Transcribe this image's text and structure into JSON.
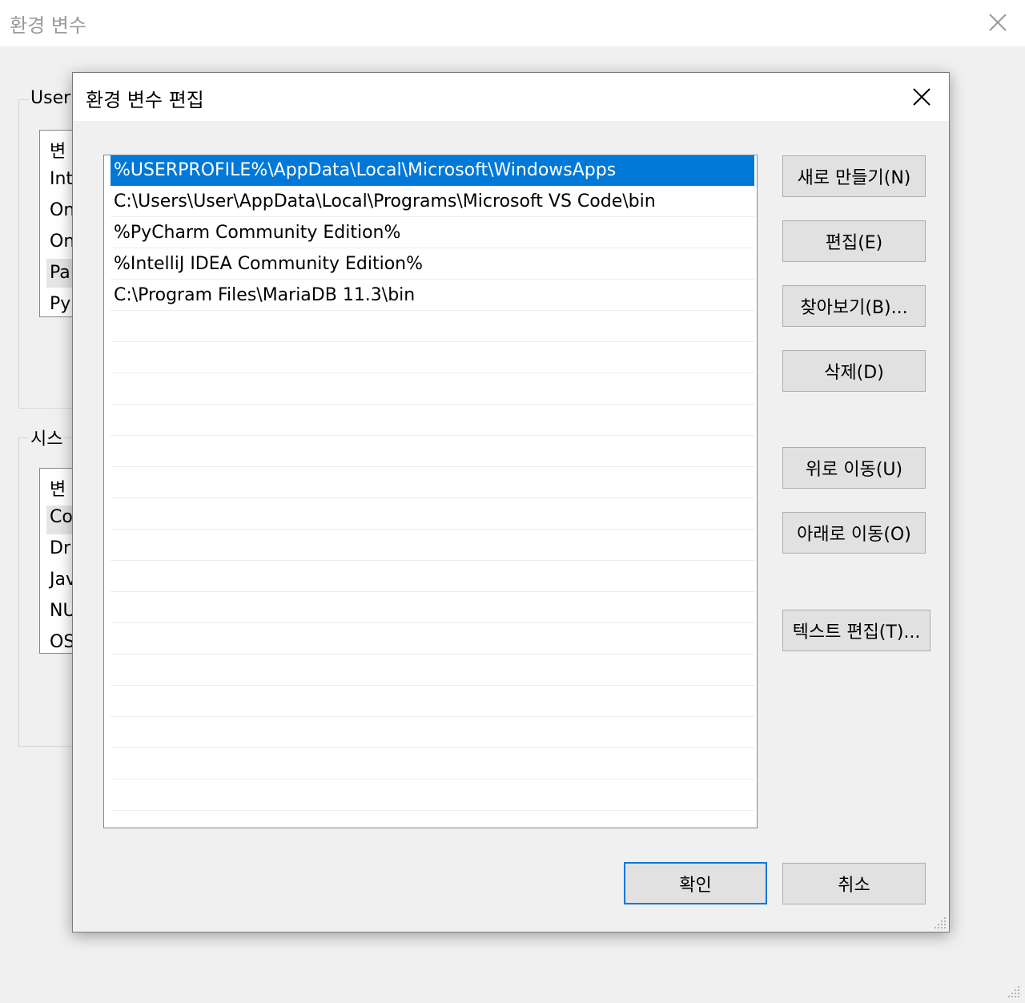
{
  "background_window": {
    "title": "환경 변수",
    "user_group_label": "User",
    "user_list": [
      "변",
      "Int",
      "On",
      "On",
      "Pa",
      "Py"
    ],
    "system_group_label": "시스",
    "system_list": [
      "변",
      "Co",
      "Dri",
      "Jav",
      "NU",
      "OS"
    ]
  },
  "dialog": {
    "title": "환경 변수 편집",
    "paths": [
      "%USERPROFILE%\\AppData\\Local\\Microsoft\\WindowsApps",
      "C:\\Users\\User\\AppData\\Local\\Programs\\Microsoft VS Code\\bin",
      "%PyCharm Community Edition%",
      "%IntelliJ IDEA Community Edition%",
      "C:\\Program Files\\MariaDB 11.3\\bin"
    ],
    "selected_index": 0,
    "buttons": {
      "new": "새로 만들기(N)",
      "edit": "편집(E)",
      "browse": "찾아보기(B)...",
      "delete": "삭제(D)",
      "move_up": "위로 이동(U)",
      "move_down": "아래로 이동(O)",
      "edit_text": "텍스트 편집(T)...",
      "ok": "확인",
      "cancel": "취소"
    }
  },
  "colors": {
    "selection": "#0078d7",
    "window_bg": "#f0f0f0",
    "button_face": "#e1e1e1"
  },
  "icons": {
    "close": "close-icon",
    "resize": "resize-grip-icon"
  }
}
